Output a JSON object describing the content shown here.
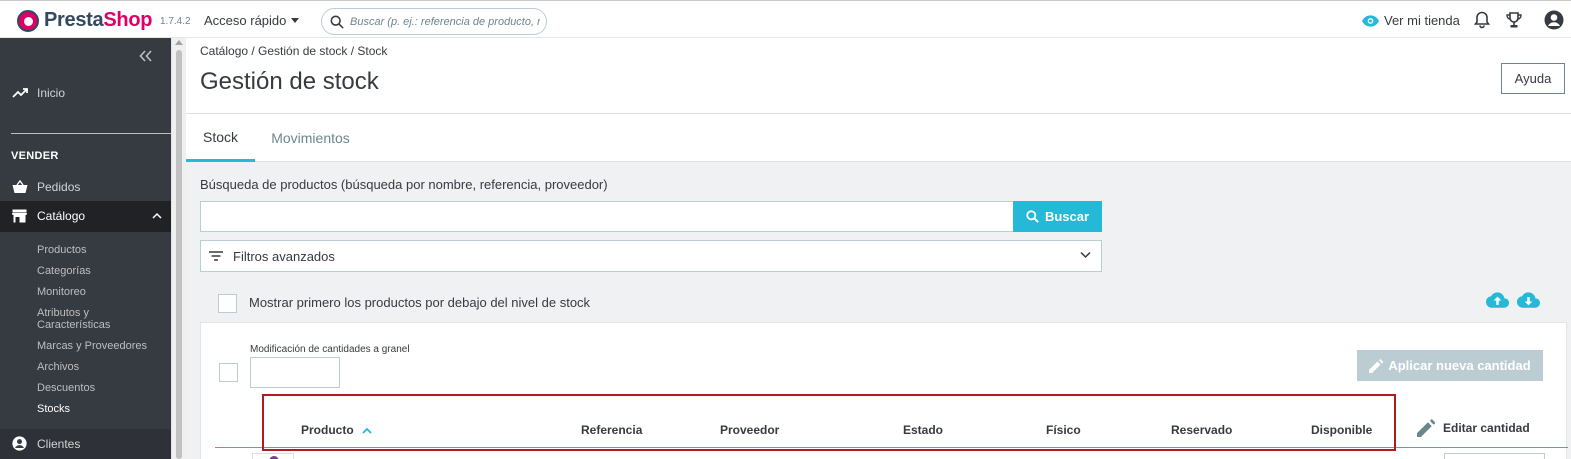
{
  "header": {
    "logo_prefix": "Presta",
    "logo_suffix": "Shop",
    "version": "1.7.4.2",
    "quick_access_label": "Acceso rápido",
    "search_placeholder": "Buscar (p. ej.: referencia de producto, nombre de cliente…)",
    "view_store_label": "Ver mi tienda"
  },
  "sidebar": {
    "home_label": "Inicio",
    "section_sell": "VENDER",
    "orders_label": "Pedidos",
    "catalog_label": "Catálogo",
    "catalog_submenu": [
      "Productos",
      "Categorías",
      "Monitoreo",
      "Atributos y Características",
      "Marcas y Proveedores",
      "Archivos",
      "Descuentos",
      "Stocks"
    ],
    "clients_label": "Clientes"
  },
  "page": {
    "breadcrumb": "Catálogo  /  Gestión de stock  /  Stock",
    "title": "Gestión de stock",
    "help_label": "Ayuda"
  },
  "tabs": {
    "stock": "Stock",
    "movements": "Movimientos"
  },
  "search": {
    "label": "Búsqueda de productos (búsqueda por nombre, referencia, proveedor)",
    "input_value": "",
    "button_label": "Buscar"
  },
  "filters": {
    "label": "Filtros avanzados"
  },
  "low_stock": {
    "label": "Mostrar primero los productos por debajo del nivel de stock"
  },
  "bulk": {
    "label": "Modificación de cantidades a granel",
    "input_value": "",
    "apply_label": "Aplicar nueva cantidad"
  },
  "table": {
    "columns": {
      "product": "Producto",
      "reference": "Referencia",
      "supplier": "Proveedor",
      "status": "Estado",
      "physical": "Físico",
      "reserved": "Reservado",
      "available": "Disponible",
      "edit_quantity": "Editar cantidad"
    }
  },
  "colors": {
    "brand_pink": "#df0067",
    "brand_dark": "#34495e",
    "accent_blue": "#25b9d7",
    "sidebar_bg": "#363a41",
    "highlight_red": "#b01b20"
  },
  "icons": {
    "search": "search-icon",
    "eye": "eye-icon",
    "bell": "bell-icon",
    "trophy": "trophy-icon",
    "user": "user-icon",
    "collapse": "double-chevron-left-icon",
    "trend": "trending-up-icon",
    "basket": "basket-icon",
    "store": "store-icon",
    "filter": "filter-list-icon",
    "chevron": "chevron-down-icon",
    "cloud_up": "cloud-upload-icon",
    "cloud_down": "cloud-download-icon",
    "pencil": "pencil-icon",
    "sort": "sort-asc-icon"
  }
}
